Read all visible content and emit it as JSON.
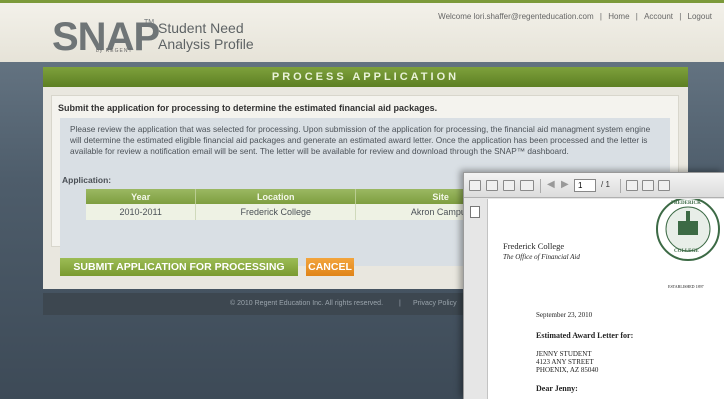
{
  "header": {
    "logo_text": "SNAP",
    "logo_tm": "TM",
    "logo_byline": "by REGENT",
    "product_line1": "Student Need",
    "product_line2": "Analysis Profile",
    "welcome": "Welcome lori.shaffer@regenteducation.com",
    "nav_home": "Home",
    "nav_account": "Account",
    "nav_logout": "Logout"
  },
  "panel": {
    "title": "PROCESS APPLICATION",
    "intro": "Submit the application for processing to determine the estimated financial aid packages.",
    "description": "Please review the application that was selected for processing. Upon submission of the application for processing, the financial aid managment system engine will determine the estimated eligible financial aid packages and generate an estimated award letter. Once the application has been processed and the letter is available for review a notification email will be sent. The letter will be available for review and download through the SNAP™ dashboard.",
    "application_label": "Application:",
    "table": {
      "headers": [
        "Year",
        "Location",
        "Site"
      ],
      "rows": [
        [
          "2010-2011",
          "Frederick College",
          "Akron Campus"
        ]
      ]
    },
    "submit_label": "SUBMIT APPLICATION FOR PROCESSING",
    "cancel_label": "CANCEL"
  },
  "footer": {
    "copyright": "© 2010 Regent Education Inc. All rights reserved.",
    "separator": "|",
    "privacy": "Privacy Policy"
  },
  "pdf": {
    "page_current": "1",
    "page_total": "/ 1",
    "college": "Frederick College",
    "office": "The Office of Financial Aid",
    "seal_top": "FREDERICK",
    "seal_bottom": "COLLEGE",
    "established": "ESTABLISHED 1897",
    "date": "September 23, 2010",
    "letter_title": "Estimated Award Letter for:",
    "student_name": "JENNY STUDENT",
    "street": "4123 ANY STREET",
    "city": "PHOENIX, AZ 85040",
    "greeting": "Dear Jenny:"
  },
  "colors": {
    "accent_green": "#7a9a30",
    "cancel_orange": "#e08418",
    "footer_bg": "#3d4750"
  }
}
